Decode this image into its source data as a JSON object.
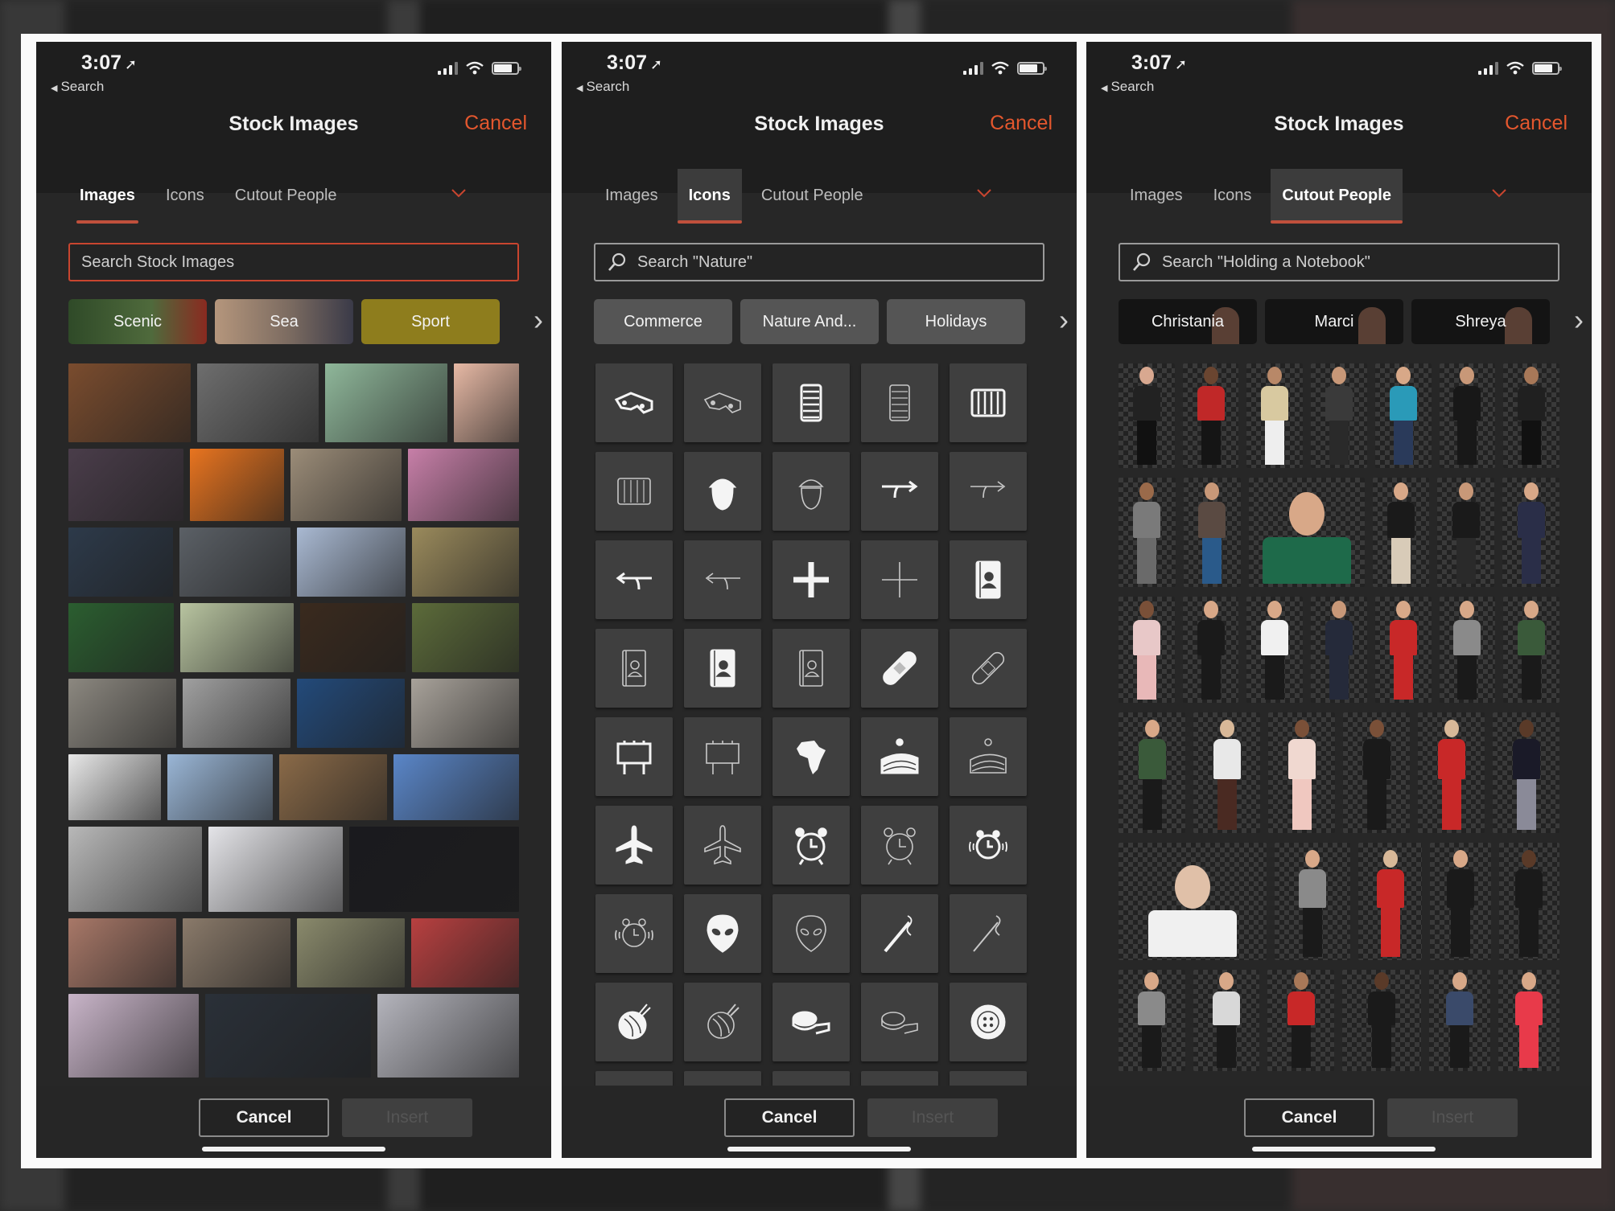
{
  "colors": {
    "accent": "#e4572e",
    "tab_underline": "#c0503c",
    "panel_bg": "#272727",
    "header_bg": "#1e1e1e",
    "icon_tile": "#3f3f3f"
  },
  "status_bar": {
    "time": "3:07",
    "back_label": "Search",
    "icons": [
      "location-arrow-icon",
      "signal-icon",
      "wifi-icon",
      "battery-icon"
    ]
  },
  "panels": [
    {
      "header": {
        "title": "Stock Images",
        "cancel": "Cancel"
      },
      "tabs": [
        {
          "label": "Images",
          "active": true
        },
        {
          "label": "Icons",
          "active": false
        },
        {
          "label": "Cutout People",
          "active": false
        }
      ],
      "search": {
        "placeholder": "Search Stock Images",
        "value": ""
      },
      "categories": [
        {
          "label": "Scenic",
          "color": "#3f5a34"
        },
        {
          "label": "Sea",
          "color": "#8b7c6c"
        },
        {
          "label": "Sport",
          "color": "#8e7d1d"
        }
      ],
      "images": [
        [
          {
            "name": "bookshelf",
            "c": "#7a4c2e",
            "w": 112
          },
          {
            "name": "metal-sphere",
            "c": "#6e6e6e",
            "w": 112
          },
          {
            "name": "paper-people",
            "c": "#8fb79a",
            "w": 112
          },
          {
            "name": "cactus",
            "c": "#e7b9a5",
            "w": 60
          }
        ],
        [
          {
            "name": "fruit-on-wood",
            "c": "#4a3d4a",
            "w": 108
          },
          {
            "name": "nautilus-orange",
            "c": "#e8741f",
            "w": 88
          },
          {
            "name": "warehouse-man",
            "c": "#9b8c78",
            "w": 104
          },
          {
            "name": "pink-beach",
            "c": "#c77fa8",
            "w": 104
          }
        ],
        [
          {
            "name": "woman-desk",
            "c": "#2d3a4a",
            "w": 96
          },
          {
            "name": "living-room",
            "c": "#5b6066",
            "w": 102
          },
          {
            "name": "snow-mountain",
            "c": "#a9b9d2",
            "w": 100
          },
          {
            "name": "daisies",
            "c": "#9a8a5c",
            "w": 98
          }
        ],
        [
          {
            "name": "green-leaves",
            "c": "#2b5e30",
            "w": 96
          },
          {
            "name": "watercolor-trees",
            "c": "#b8c4a0",
            "w": 104
          },
          {
            "name": "mandrill",
            "c": "#3a2a1e",
            "w": 96
          },
          {
            "name": "woman-plants",
            "c": "#5c6b3a",
            "w": 98
          }
        ],
        [
          {
            "name": "rock-texture",
            "c": "#8c8880",
            "w": 98
          },
          {
            "name": "spiral-stairs",
            "c": "#a0a0a0",
            "w": 98
          },
          {
            "name": "lab-scientist",
            "c": "#234a7a",
            "w": 98
          },
          {
            "name": "office-room",
            "c": "#a8a29a",
            "w": 98
          }
        ],
        [
          {
            "name": "xy-letters",
            "c": "#e8e8e8",
            "w": 84
          },
          {
            "name": "golden-gate-fog",
            "c": "#9ab6d6",
            "w": 96
          },
          {
            "name": "bread-loaves",
            "c": "#8a6a48",
            "w": 98
          },
          {
            "name": "blue-flowers",
            "c": "#5a86c8",
            "w": 114
          }
        ],
        [
          {
            "name": "birch-trees",
            "c": "#b8b8b8",
            "w": 118
          },
          {
            "name": "phone-wall",
            "c": "#e4e4e8",
            "w": 118
          },
          {
            "name": "crown-dark",
            "c": "#1a1a1e",
            "w": 150
          }
        ],
        [
          {
            "name": "woman-sunset",
            "c": "#a87868",
            "w": 98
          },
          {
            "name": "man-sleeping",
            "c": "#8a7a6a",
            "w": 98
          },
          {
            "name": "carrots",
            "c": "#8a8a6c",
            "w": 98
          },
          {
            "name": "umbrellas",
            "c": "#b84040",
            "w": 98
          }
        ],
        [
          {
            "name": "oil-rig",
            "c": "#c8b4c8",
            "w": 116
          },
          {
            "name": "dark-fabric",
            "c": "#2a3038",
            "w": 148
          },
          {
            "name": "balance-spheres",
            "c": "#b4b4bc",
            "w": 126
          }
        ]
      ],
      "footer": {
        "cancel": "Cancel",
        "insert": "Insert"
      }
    },
    {
      "header": {
        "title": "Stock Images",
        "cancel": "Cancel"
      },
      "tabs": [
        {
          "label": "Images",
          "active": false
        },
        {
          "label": "Icons",
          "active": true
        },
        {
          "label": "Cutout People",
          "active": false
        }
      ],
      "search": {
        "placeholder": "Search \"Nature\"",
        "value": ""
      },
      "categories": [
        {
          "label": "Commerce",
          "color": "#555555"
        },
        {
          "label": "Nature And...",
          "color": "#555555"
        },
        {
          "label": "Holidays",
          "color": "#555555"
        }
      ],
      "icons": [
        {
          "name": "3d-glasses",
          "style": "filled"
        },
        {
          "name": "3d-glasses",
          "style": "outline"
        },
        {
          "name": "abacus",
          "style": "filled"
        },
        {
          "name": "abacus",
          "style": "outline"
        },
        {
          "name": "abacus-wide",
          "style": "filled"
        },
        {
          "name": "abacus-wide",
          "style": "outline"
        },
        {
          "name": "acorn",
          "style": "filled"
        },
        {
          "name": "acorn",
          "style": "outline"
        },
        {
          "name": "arrow-merge-right",
          "style": "filled"
        },
        {
          "name": "arrow-merge-right",
          "style": "outline"
        },
        {
          "name": "arrow-merge-left",
          "style": "filled"
        },
        {
          "name": "arrow-merge-left",
          "style": "outline"
        },
        {
          "name": "plus",
          "style": "filled"
        },
        {
          "name": "plus",
          "style": "outline"
        },
        {
          "name": "address-book",
          "style": "filled"
        },
        {
          "name": "address-book",
          "style": "outline"
        },
        {
          "name": "address-book-alt",
          "style": "filled"
        },
        {
          "name": "address-book-alt",
          "style": "outline"
        },
        {
          "name": "adhesive-bandage",
          "style": "filled"
        },
        {
          "name": "adhesive-bandage",
          "style": "outline"
        },
        {
          "name": "billboard",
          "style": "filled"
        },
        {
          "name": "billboard",
          "style": "outline"
        },
        {
          "name": "africa",
          "style": "filled"
        },
        {
          "name": "farmland",
          "style": "filled"
        },
        {
          "name": "farmland",
          "style": "outline"
        },
        {
          "name": "airplane",
          "style": "filled"
        },
        {
          "name": "airplane",
          "style": "outline"
        },
        {
          "name": "alarm-clock",
          "style": "filled"
        },
        {
          "name": "alarm-clock",
          "style": "outline"
        },
        {
          "name": "alarm-ringing",
          "style": "filled"
        },
        {
          "name": "alarm-ringing",
          "style": "outline"
        },
        {
          "name": "alien",
          "style": "filled"
        },
        {
          "name": "alien",
          "style": "outline"
        },
        {
          "name": "sewing-needle",
          "style": "filled"
        },
        {
          "name": "sewing-needle",
          "style": "outline"
        },
        {
          "name": "yarn-ball",
          "style": "filled"
        },
        {
          "name": "yarn-ball",
          "style": "outline"
        },
        {
          "name": "tape-measure",
          "style": "filled"
        },
        {
          "name": "tape-measure",
          "style": "outline"
        },
        {
          "name": "button",
          "style": "filled"
        }
      ],
      "footer": {
        "cancel": "Cancel",
        "insert": "Insert"
      }
    },
    {
      "header": {
        "title": "Stock Images",
        "cancel": "Cancel"
      },
      "tabs": [
        {
          "label": "Images",
          "active": false
        },
        {
          "label": "Icons",
          "active": false
        },
        {
          "label": "Cutout People",
          "active": true
        }
      ],
      "search": {
        "placeholder": "Search \"Holding a Notebook\"",
        "value": ""
      },
      "categories": [
        {
          "label": "Christania",
          "color": "#141414"
        },
        {
          "label": "Marci",
          "color": "#141414"
        },
        {
          "label": "Shreya",
          "color": "#141414"
        }
      ],
      "people": [
        [
          {
            "top": "#222",
            "bottom": "#111",
            "skin": "#d8a890",
            "w": 64
          },
          {
            "top": "#c02828",
            "bottom": "#151515",
            "skin": "#6a4530",
            "w": 64
          },
          {
            "top": "#d8c9a0",
            "bottom": "#eeeeee",
            "skin": "#b88868",
            "w": 64
          },
          {
            "top": "#3a3a3a",
            "bottom": "#2a2a2a",
            "skin": "#c89878",
            "w": 64
          },
          {
            "top": "#2a9ab8",
            "bottom": "#2a3a5a",
            "skin": "#d8a888",
            "w": 64
          },
          {
            "top": "#181818",
            "bottom": "#181818",
            "skin": "#c89878",
            "w": 64
          },
          {
            "top": "#202020",
            "bottom": "#111",
            "skin": "#a87858",
            "w": 64
          }
        ],
        [
          {
            "top": "#7a7a7a",
            "bottom": "#6a6a6a",
            "skin": "#9a6a4a",
            "w": 64
          },
          {
            "top": "#5a4a42",
            "bottom": "#2a5a8a",
            "skin": "#c89878",
            "w": 64
          },
          {
            "top": "#1e6a4a",
            "bottom": "#1e6a4a",
            "skin": "#d8a888",
            "w": 130
          },
          {
            "top": "#1a1a1a",
            "bottom": "#d8cbb8",
            "skin": "#d8a888",
            "w": 64
          },
          {
            "top": "#1a1a1a",
            "bottom": "#2a2a2a",
            "skin": "#c89878",
            "w": 64
          },
          {
            "top": "#2a2e48",
            "bottom": "#2a2e48",
            "skin": "#d8a888",
            "w": 64
          }
        ],
        [
          {
            "top": "#e8c8c8",
            "bottom": "#e8b8b8",
            "skin": "#7a5038",
            "w": 64
          },
          {
            "top": "#1a1a1a",
            "bottom": "#1a1a1a",
            "skin": "#d8a888",
            "w": 64
          },
          {
            "top": "#f0f0f0",
            "bottom": "#1a1a1a",
            "skin": "#d8a888",
            "w": 64
          },
          {
            "top": "#252a3a",
            "bottom": "#252a3a",
            "skin": "#c89878",
            "w": 64
          },
          {
            "top": "#c82828",
            "bottom": "#c82828",
            "skin": "#d8a888",
            "w": 64
          },
          {
            "top": "#8a8a8a",
            "bottom": "#1a1a1a",
            "skin": "#d8a888",
            "w": 64
          },
          {
            "top": "#3a5a3a",
            "bottom": "#1a1a1a",
            "skin": "#d8a888",
            "w": 64
          }
        ],
        [
          {
            "top": "#3a5a3a",
            "bottom": "#1a1a1a",
            "skin": "#d8a888",
            "w": 76
          },
          {
            "top": "#e8e8e8",
            "bottom": "#4a2a22",
            "skin": "#d8b898",
            "w": 76
          },
          {
            "top": "#f0d8d0",
            "bottom": "#f0c8c0",
            "skin": "#7a5038",
            "w": 76
          },
          {
            "top": "#1a1a1a",
            "bottom": "#1a1a1a",
            "skin": "#7a5038",
            "w": 76
          },
          {
            "top": "#c82828",
            "bottom": "#c82828",
            "skin": "#d8b898",
            "w": 76
          },
          {
            "top": "#1a1a28",
            "bottom": "#8a8a98",
            "skin": "#5a3a28",
            "w": 76
          }
        ],
        [
          {
            "top": "#f0f0f0",
            "bottom": "#f0f0f0",
            "skin": "#e0c0a8",
            "w": 176
          },
          {
            "top": "#8a8a8a",
            "bottom": "#1a1a1a",
            "skin": "#d8a888",
            "w": 90
          },
          {
            "top": "#c82828",
            "bottom": "#c82828",
            "skin": "#d8b898",
            "w": 76
          },
          {
            "top": "#1a1a1a",
            "bottom": "#1a1a1a",
            "skin": "#d8a888",
            "w": 72
          },
          {
            "top": "#1a1a1a",
            "bottom": "#1a1a1a",
            "skin": "#5a3a28",
            "w": 72
          }
        ],
        [
          {
            "top": "#8a8a8a",
            "bottom": "#1a1a1a",
            "skin": "#d8a888",
            "w": 76
          },
          {
            "top": "#d8d8d8",
            "bottom": "#1a1a1a",
            "skin": "#d8a888",
            "w": 76
          },
          {
            "top": "#c82828",
            "bottom": "#1a1a1a",
            "skin": "#a87858",
            "w": 76
          },
          {
            "top": "#1a1a1a",
            "bottom": "#1a1a1a",
            "skin": "#5a3a28",
            "w": 90
          },
          {
            "top": "#3a4a6a",
            "bottom": "#1a1a1a",
            "skin": "#d8a888",
            "w": 70
          },
          {
            "top": "#e83a4a",
            "bottom": "#e83a4a",
            "skin": "#d8a888",
            "w": 70
          }
        ]
      ],
      "footer": {
        "cancel": "Cancel",
        "insert": "Insert"
      }
    }
  ]
}
